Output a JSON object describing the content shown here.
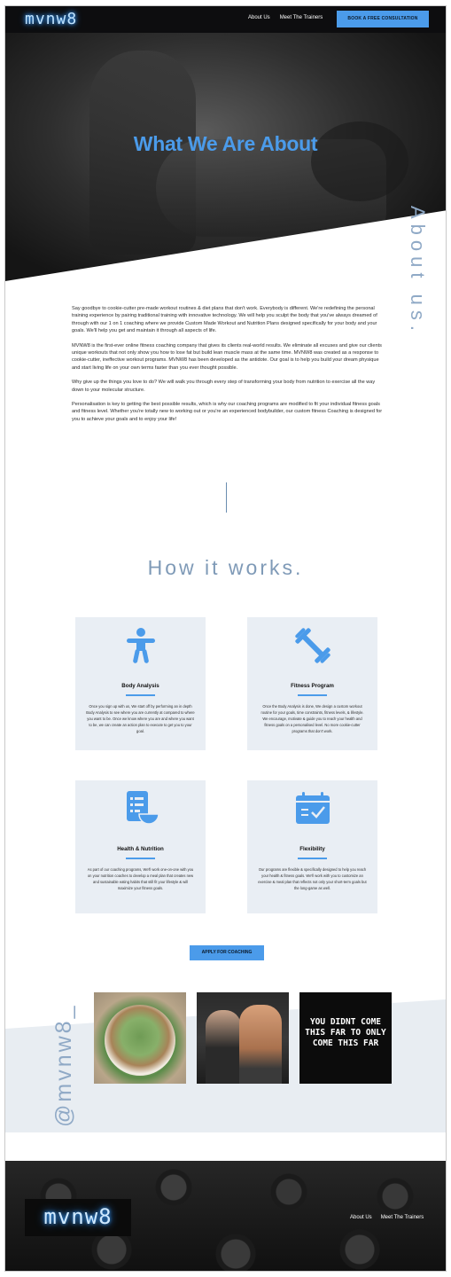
{
  "nav": {
    "logo": "mvnw8",
    "links": [
      "About Us",
      "Meet The Trainers"
    ],
    "cta": "BOOK A FREE CONSULTATION"
  },
  "hero": {
    "title": "What We Are About",
    "side_label": "About us."
  },
  "about": {
    "paragraphs": [
      "Say goodbye to cookie-cutter pre-made workout routines & diet plans that don't work. Everybody is different. We're redefining the personal training experience by pairing traditional training with innovative technology. We will help you sculpt the body that you've always dreamed of through with our 1 on 1 coaching where we provide Custom Made Workout and Nutrition Plans designed specifically for your body and your goals. We'll help you get and maintain it through all aspects of life.",
      "MVNW8 is the first-ever online fitness coaching company that gives its clients real-world results. We eliminate all excuses and give our clients unique workouts that not only show you how to lose fat but build lean muscle mass at the same time. MVNW8 was created as a response to cookie-cutter, ineffective workout programs. MVNW8 has been developed as the antidote. Our goal is to help you build your dream physique and start living life on your own terms faster than you ever thought possible.",
      "Why give up the things you love to do? We will walk you through every step of transforming your body from nutrition to exercise all the way down to your molecular structure.",
      "Personalisation is key to getting the best possible results, which is why our coaching programs are modified to fit your individual fitness goals and fitness level. Whether you're totally new to working out or you're an experienced bodybuilder, our custom fitness Coaching is designed for you to achieve your goals and to enjoy your life!"
    ]
  },
  "how": {
    "title": "How it works.",
    "cards": [
      {
        "title": "Body Analysis",
        "icon": "person-icon",
        "text": "Once you sign up with us, We start off by performing an in depth Body Analysis to see where you are currently at compared to where you want to be. Once we know where you are and where you want to be, we can create an action plan to execute to get you to your goal."
      },
      {
        "title": "Fitness Program",
        "icon": "dumbbell-icon",
        "text": "Once the Body Analysis is done, We design a custom workout routine for your goals, time constraints, fitness levels, & lifestyle. We encourage, motivate & guide you to reach your health and fitness goals on a personalised level. No more cookie-cutter programs that don't work."
      },
      {
        "title": "Health & Nutrition",
        "icon": "nutrition-plan-icon",
        "text": "As part of our coaching programs, We'll work one-on-one with you on your nutrition coaches to develop a meal plan that creates new and sustainable eating habits that still fit your lifestyle & will maximize your fitness goals."
      },
      {
        "title": "Flexibility",
        "icon": "calendar-check-icon",
        "text": "Our programs are flexible & specifically designed to help you reach your health & fitness goals. We'll work with you to customize an exercise & meal plan that reflects not only your short-term goals but the long-game as well."
      }
    ],
    "cta": "APPLY FOR COACHING"
  },
  "instagram": {
    "handle": "@mvnw8_",
    "quote": "YOU DIDNT COME THIS FAR TO ONLY COME THIS FAR"
  },
  "footer": {
    "logo": "mvnw8",
    "links": [
      "About Us",
      "Meet The Trainers"
    ]
  },
  "colors": {
    "accent": "#4b9bea",
    "muted_blue": "#8fa9c6",
    "card_bg": "#e9eef4"
  }
}
